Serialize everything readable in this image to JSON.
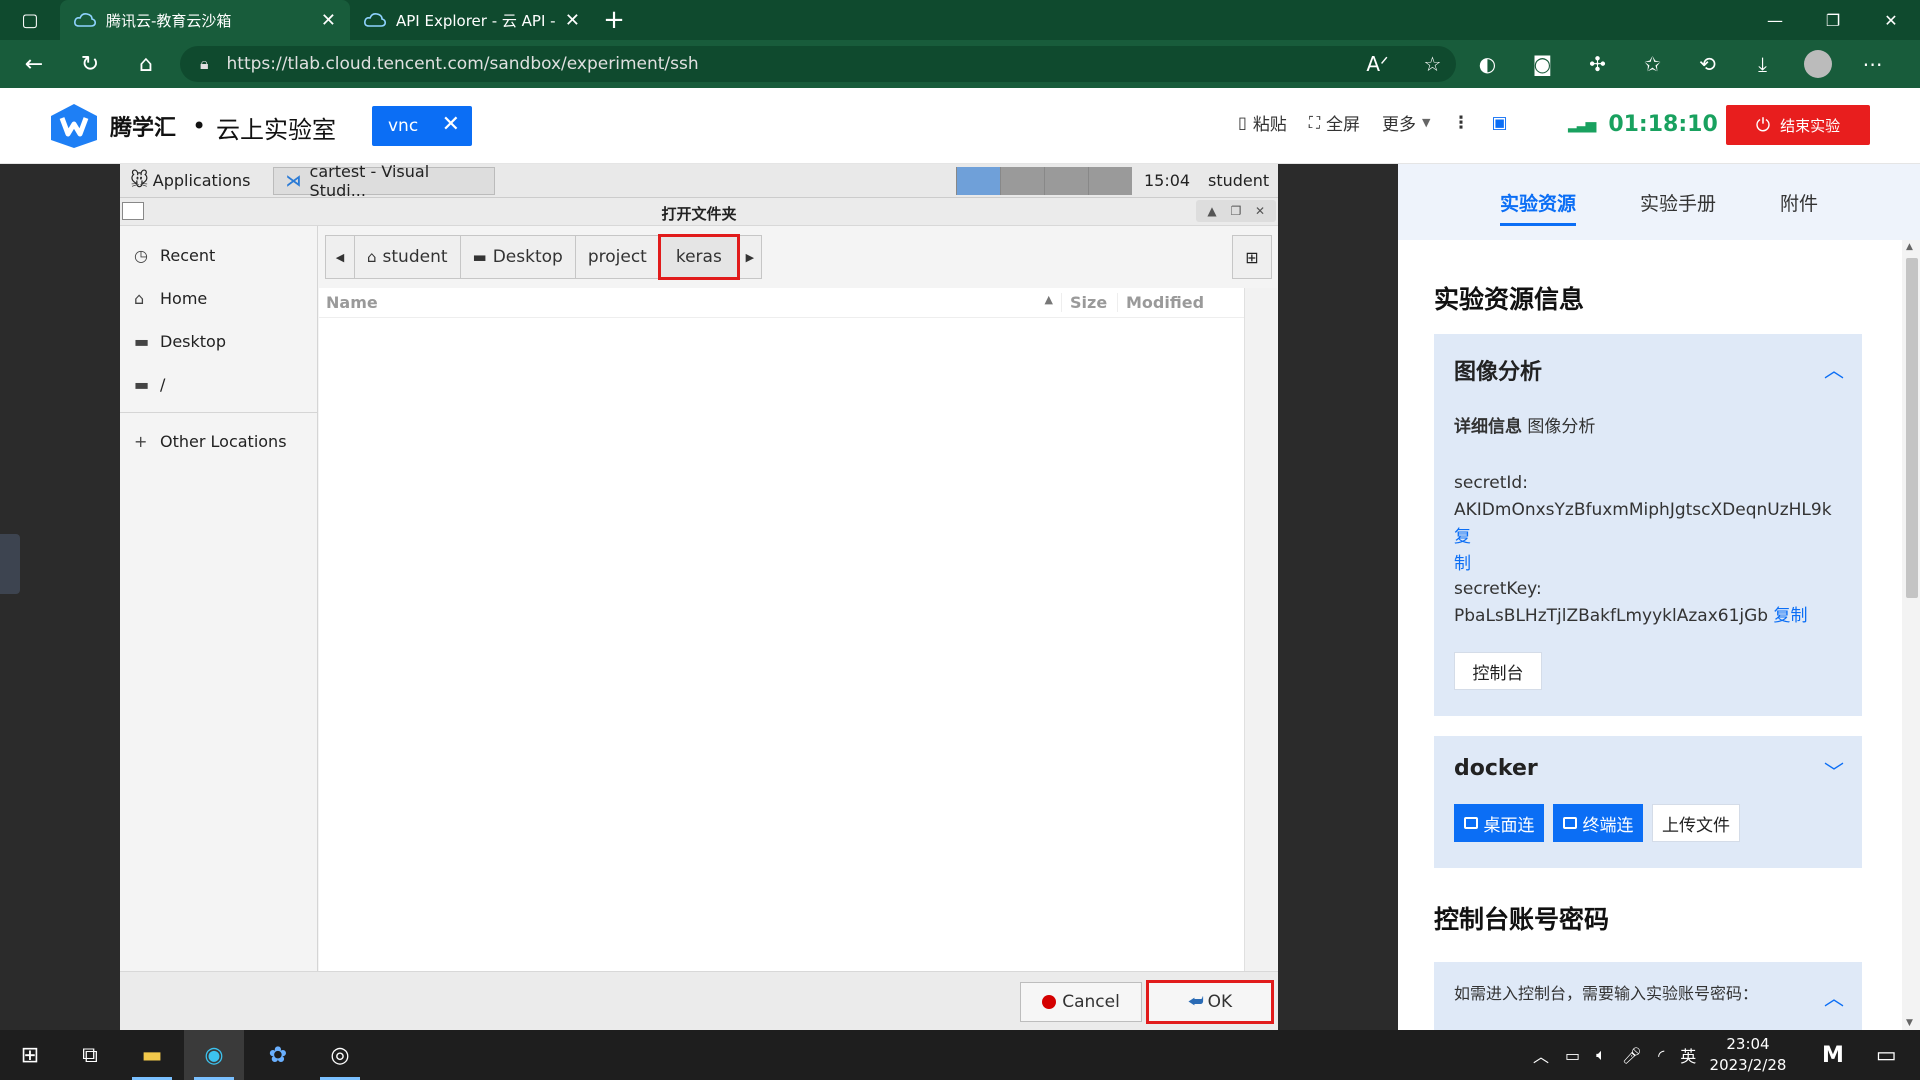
{
  "browser": {
    "tabs": [
      {
        "title": "腾讯云-教育云沙箱",
        "active": true
      },
      {
        "title": "API Explorer - 云 API - 控制台",
        "active": false
      }
    ],
    "url": "https://tlab.cloud.tencent.com/sandbox/experiment/ssh"
  },
  "header": {
    "brand": "腾学汇",
    "dot": "•",
    "subtitle": "云上实验室",
    "vnc_tag": "vnc",
    "paste": "粘贴",
    "fullscreen": "全屏",
    "more": "更多",
    "timer": "01:18:10",
    "end_button": "结束实验",
    "accent": "#0b6ef5",
    "danger": "#e81e1e",
    "timer_color": "#19a15f"
  },
  "vnc": {
    "panel": {
      "applications": "Applications",
      "task": "cartest - Visual Studi...",
      "clock": "15:04",
      "user": "student"
    },
    "dialog": {
      "title": "打开文件夹",
      "places": [
        "Recent",
        "Home",
        "Desktop",
        "/"
      ],
      "other_locations": "Other Locations",
      "path": [
        "student",
        "Desktop",
        "project",
        "keras"
      ],
      "columns": {
        "name": "Name",
        "size": "Size",
        "modified": "Modified"
      },
      "cancel": "Cancel",
      "ok": "OK"
    }
  },
  "right": {
    "tabs": [
      "实验资源",
      "实验手册",
      "附件"
    ],
    "section_title": "实验资源信息",
    "card1": {
      "title": "图像分析",
      "detail_label": "详细信息",
      "detail_value": "图像分析",
      "secret_id_label": "secretId:",
      "secret_id": "AKIDmOnxsYzBfuxmMiphJgtscXDeqnUzHL9k",
      "secret_key_label": "secretKey:",
      "secret_key": "PbaLsBLHzTjlZBakfLmyyklAzax61jGb",
      "copy": "复制",
      "copy_a": "复",
      "copy_b": "制",
      "console_button": "控制台"
    },
    "card2": {
      "title": "docker",
      "desktop_btn": "桌面连",
      "terminal_btn": "终端连",
      "upload_btn": "上传文件"
    },
    "section2_title": "控制台账号密码",
    "card3_text": "如需进入控制台，需要输入实验账号密码："
  },
  "taskbar": {
    "time": "23:04",
    "date": "2023/2/28",
    "ime": "英"
  }
}
